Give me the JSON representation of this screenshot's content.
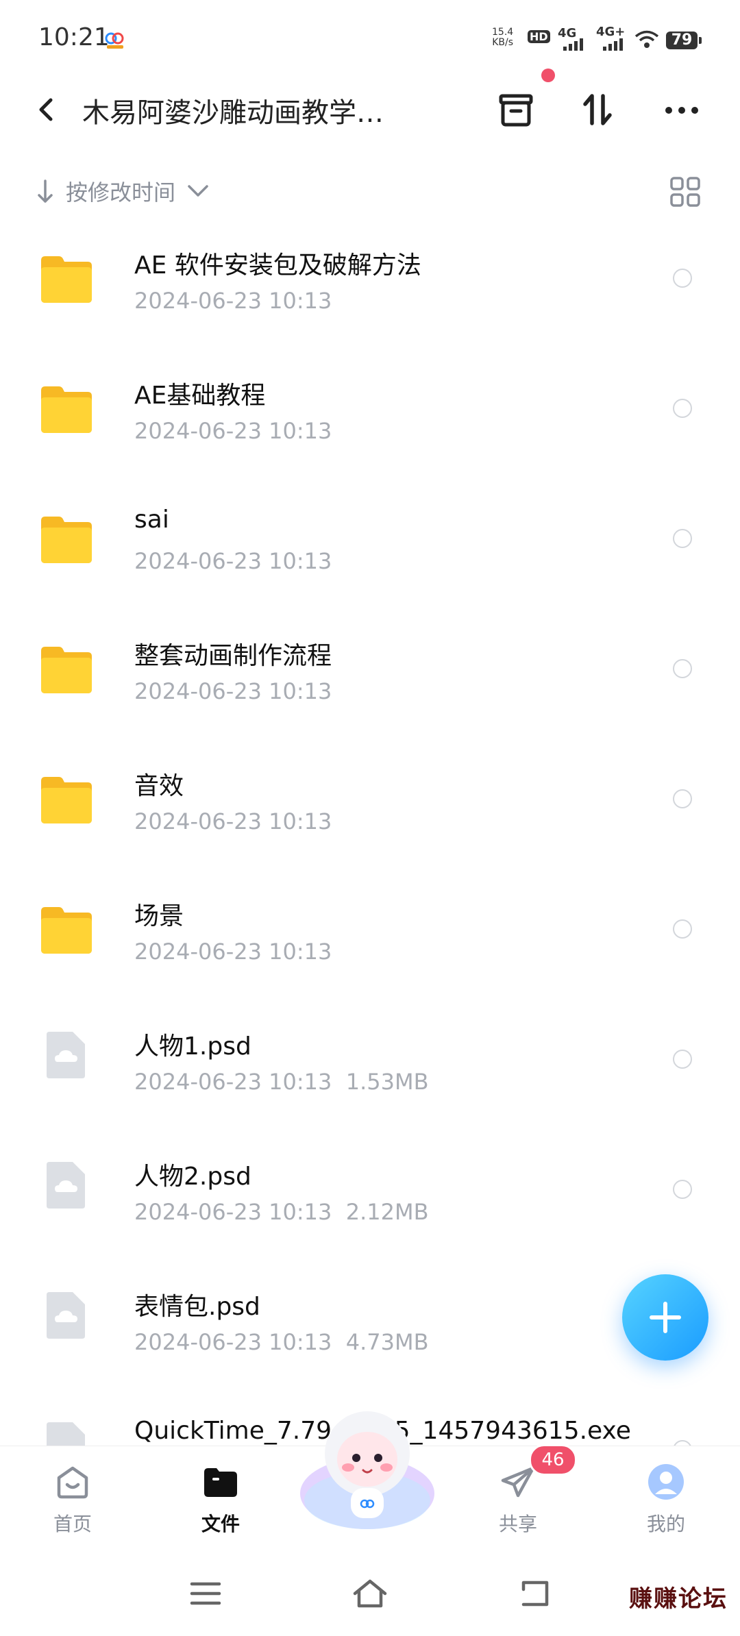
{
  "status_bar": {
    "time": "10:21",
    "net_speed_value": "15.4",
    "net_speed_unit": "KB/s",
    "hd": "HD",
    "signal_1": "4G",
    "signal_2": "4G+",
    "battery": "79"
  },
  "header": {
    "title": "木易阿婆沙雕动画教学…",
    "icons": [
      "back-arrow-icon",
      "archive-icon",
      "transfer-icon",
      "more-icon"
    ],
    "notification_dot_color": "#f0506a"
  },
  "sort_bar": {
    "label": "按修改时间",
    "icons": [
      "sort-arrow-icon",
      "chevron-down-icon",
      "grid-view-icon"
    ]
  },
  "files": [
    {
      "type": "folder",
      "name": "AE 软件安装包及破解方法",
      "date": "2024-06-23  10:13",
      "size": ""
    },
    {
      "type": "folder",
      "name": "AE基础教程",
      "date": "2024-06-23  10:13",
      "size": ""
    },
    {
      "type": "folder",
      "name": "sai",
      "date": "2024-06-23  10:13",
      "size": ""
    },
    {
      "type": "folder",
      "name": "整套动画制作流程",
      "date": "2024-06-23  10:13",
      "size": ""
    },
    {
      "type": "folder",
      "name": "音效",
      "date": "2024-06-23  10:13",
      "size": ""
    },
    {
      "type": "folder",
      "name": "场景",
      "date": "2024-06-23  10:13",
      "size": ""
    },
    {
      "type": "file",
      "name": "人物1.psd",
      "date": "2024-06-23  10:13",
      "size": "1.53MB"
    },
    {
      "type": "file",
      "name": "人物2.psd",
      "date": "2024-06-23  10:13",
      "size": "2.12MB"
    },
    {
      "type": "file",
      "name": "表情包.psd",
      "date": "2024-06-23  10:13",
      "size": "4.73MB"
    },
    {
      "type": "file",
      "name": "QuickTime_7.79.80.95_1457943615.exe",
      "date": "",
      "size": ""
    }
  ],
  "fab": {
    "icon": "plus-icon",
    "color": "#1a9cff"
  },
  "tab_bar": {
    "tabs": [
      {
        "label": "首页",
        "icon": "home-icon",
        "active": false
      },
      {
        "label": "文件",
        "icon": "folder-tab-icon",
        "active": true
      },
      {
        "label": "共享",
        "icon": "send-icon",
        "active": false,
        "badge": "46"
      },
      {
        "label": "我的",
        "icon": "avatar-icon",
        "active": false
      }
    ]
  },
  "nav_bar": {
    "icons": [
      "menu-icon",
      "home-nav-icon",
      "back-nav-icon"
    ]
  },
  "watermark": "赚赚论坛"
}
